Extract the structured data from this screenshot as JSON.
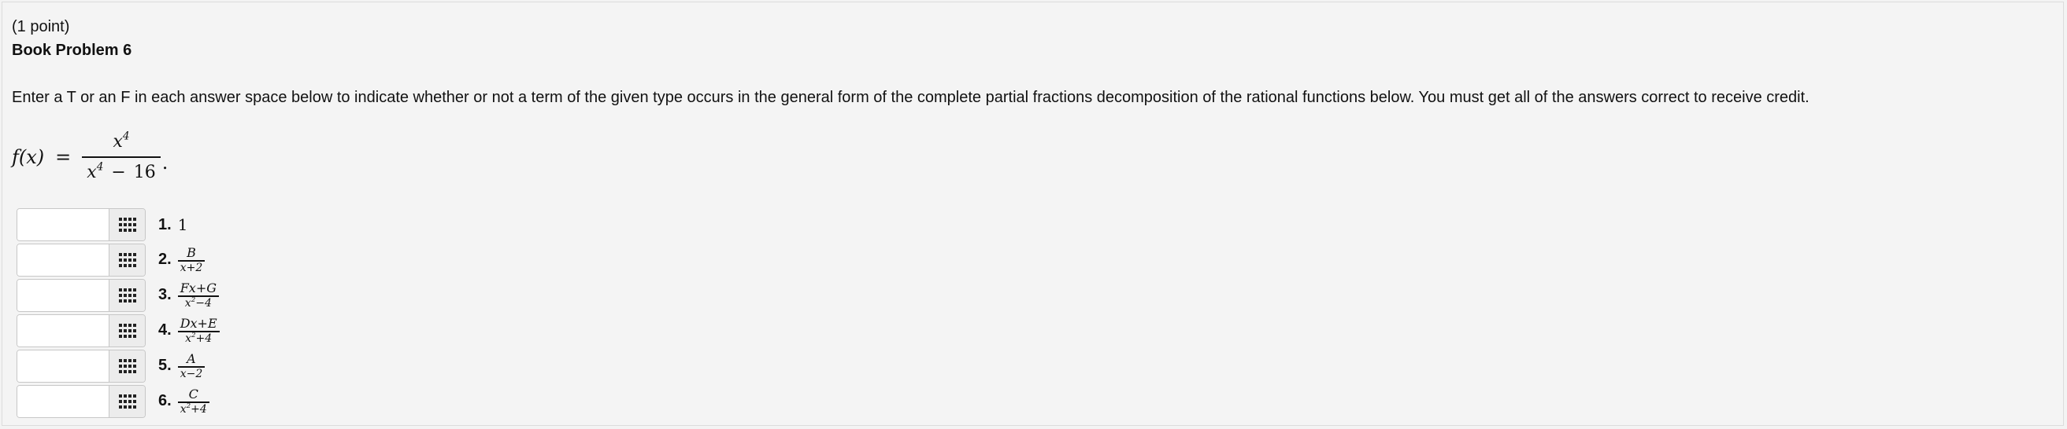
{
  "problem": {
    "points": "(1 point)",
    "title": "Book Problem 6",
    "instructions": "Enter a T or an F in each answer space below to indicate whether or not a term of the given type occurs in the general form of the complete partial fractions decomposition of the rational functions below. You must get all of the answers correct to receive credit."
  },
  "function": {
    "lhs": "f(x)",
    "eq": "=",
    "num_base": "x",
    "num_exp": "4",
    "den_base": "x",
    "den_exp": "4",
    "den_op": "−",
    "den_const": "16",
    "period": "."
  },
  "answers": [
    {
      "number": "1.",
      "term": {
        "plain": "1"
      },
      "value": "",
      "button_icon": "grid-icon"
    },
    {
      "number": "2.",
      "term": {
        "num": "B",
        "den": "x+2"
      },
      "value": "",
      "button_icon": "grid-icon"
    },
    {
      "number": "3.",
      "term": {
        "num": "Fx+G",
        "den_base": "x",
        "den_exp": "2",
        "den_rest": "−4"
      },
      "value": "",
      "button_icon": "grid-icon"
    },
    {
      "number": "4.",
      "term": {
        "num": "Dx+E",
        "den_base": "x",
        "den_exp": "2",
        "den_rest": "+4"
      },
      "value": "",
      "button_icon": "grid-icon"
    },
    {
      "number": "5.",
      "term": {
        "num": "A",
        "den": "x−2"
      },
      "value": "",
      "button_icon": "grid-icon"
    },
    {
      "number": "6.",
      "term": {
        "num": "C",
        "den_base": "x",
        "den_exp": "2",
        "den_rest": "+4"
      },
      "value": "",
      "button_icon": "grid-icon"
    }
  ]
}
